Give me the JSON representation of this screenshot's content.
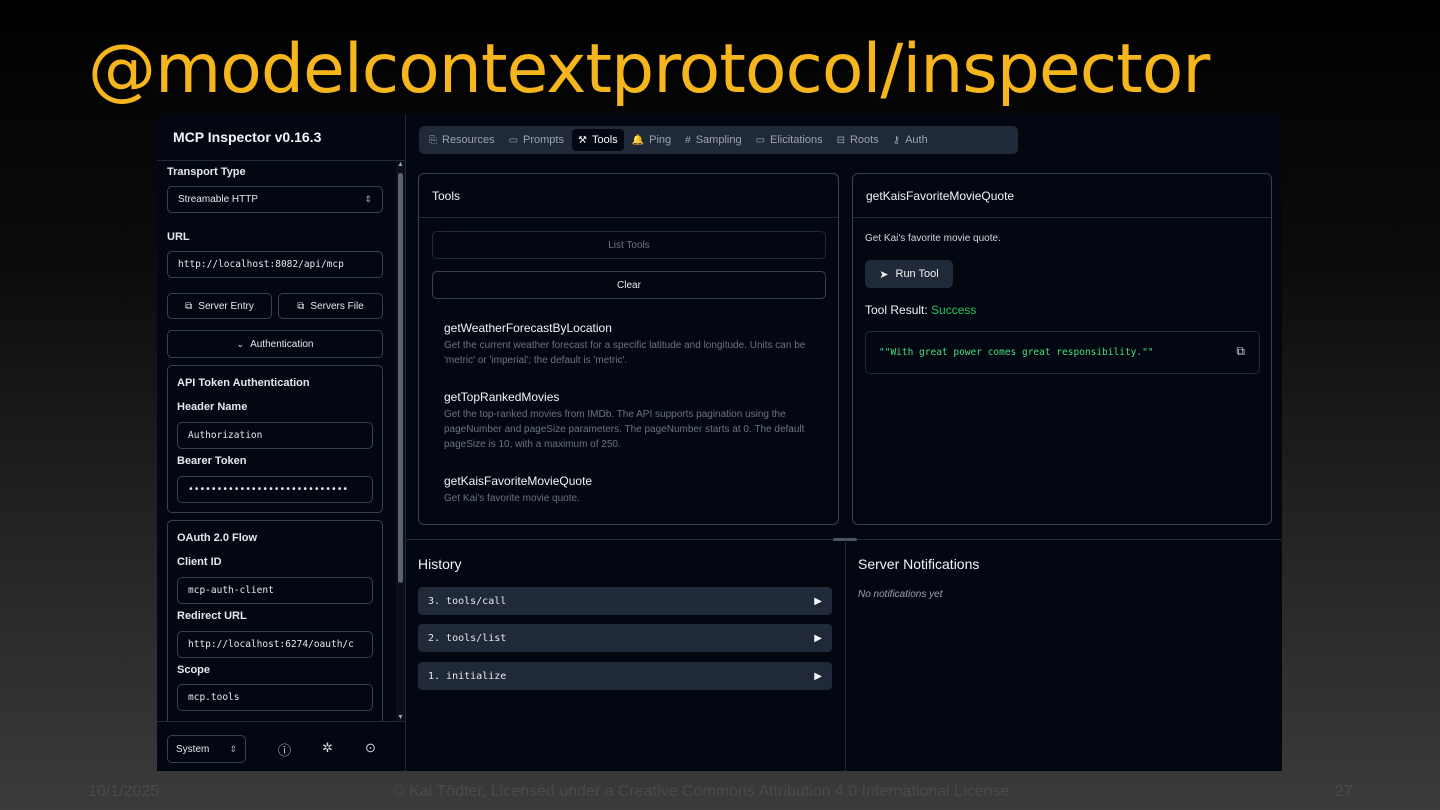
{
  "slide": {
    "title": "@modelcontextprotocol/inspector",
    "footer_date": "10/1/2025",
    "footer_copyright": "© Kai Tödter, Licensed under a Creative Commons Attribution 4.0 International License.",
    "footer_page": "27"
  },
  "sidebar": {
    "app_title": "MCP Inspector v0.16.3",
    "transport_label": "Transport Type",
    "transport_value": "Streamable HTTP",
    "url_label": "URL",
    "url_value": "http://localhost:8082/api/mcp",
    "server_entry_btn": "Server Entry",
    "servers_file_btn": "Servers File",
    "auth_toggle": "Authentication",
    "api_token": {
      "heading": "API Token Authentication",
      "header_name_label": "Header Name",
      "header_name_value": "Authorization",
      "bearer_label": "Bearer Token",
      "bearer_value": "••••••••••••••••••••••••••••"
    },
    "oauth": {
      "heading": "OAuth 2.0 Flow",
      "client_id_label": "Client ID",
      "client_id_value": "mcp-auth-client",
      "redirect_label": "Redirect URL",
      "redirect_value": "http://localhost:6274/oauth/c",
      "scope_label": "Scope",
      "scope_value": "mcp.tools"
    },
    "theme_select": "System"
  },
  "tabs": [
    {
      "label": "Resources",
      "icon": "⎘"
    },
    {
      "label": "Prompts",
      "icon": "▭"
    },
    {
      "label": "Tools",
      "icon": "⚒"
    },
    {
      "label": "Ping",
      "icon": "🔔"
    },
    {
      "label": "Sampling",
      "icon": "#"
    },
    {
      "label": "Elicitations",
      "icon": "▭"
    },
    {
      "label": "Roots",
      "icon": "⊟"
    },
    {
      "label": "Auth",
      "icon": "⚷"
    }
  ],
  "tools_panel": {
    "title": "Tools",
    "list_btn": "List Tools",
    "clear_btn": "Clear",
    "items": [
      {
        "name": "getWeatherForecastByLocation",
        "desc": "Get the current weather forecast for a specific latitude and longitude. Units can be 'metric' or 'imperial'; the default is 'metric'."
      },
      {
        "name": "getTopRankedMovies",
        "desc": "Get the top-ranked movies from IMDb. The API supports pagination using the pageNumber and pageSize parameters. The pageNumber starts at 0. The default pageSize is 10, with a maximum of 250."
      },
      {
        "name": "getKaisFavoriteMovieQuote",
        "desc": "Get Kai's favorite movie quote."
      }
    ]
  },
  "detail_panel": {
    "title": "getKaisFavoriteMovieQuote",
    "desc": "Get Kai's favorite movie quote.",
    "run_btn": "Run Tool",
    "result_label": "Tool Result:",
    "result_status": "Success",
    "result_text": "\"\"With great power comes great responsibility.\"\""
  },
  "history": {
    "title": "History",
    "items": [
      "3. tools/call",
      "2. tools/list",
      "1. initialize"
    ]
  },
  "notifications": {
    "title": "Server Notifications",
    "empty": "No notifications yet"
  },
  "colors": {
    "title_accent": "#f5b51c",
    "success": "#22c55e",
    "result_text": "#4ade80"
  }
}
